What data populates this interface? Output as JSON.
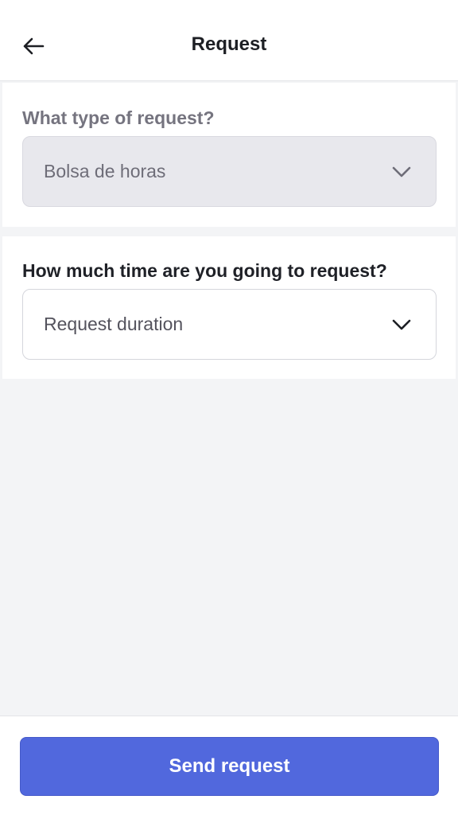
{
  "header": {
    "title": "Request",
    "back_icon": "arrow-left-icon"
  },
  "request_type": {
    "label": "What type of request?",
    "value": "Bolsa de horas",
    "state": "disabled",
    "icon": "chevron-down-icon"
  },
  "duration": {
    "label": "How much time are you going to request?",
    "placeholder": "Request duration",
    "icon": "chevron-down-icon"
  },
  "footer": {
    "send_label": "Send request"
  },
  "colors": {
    "accent": "#5168dd",
    "background": "#f3f4f6",
    "disabled_field": "#e8e8ed"
  }
}
